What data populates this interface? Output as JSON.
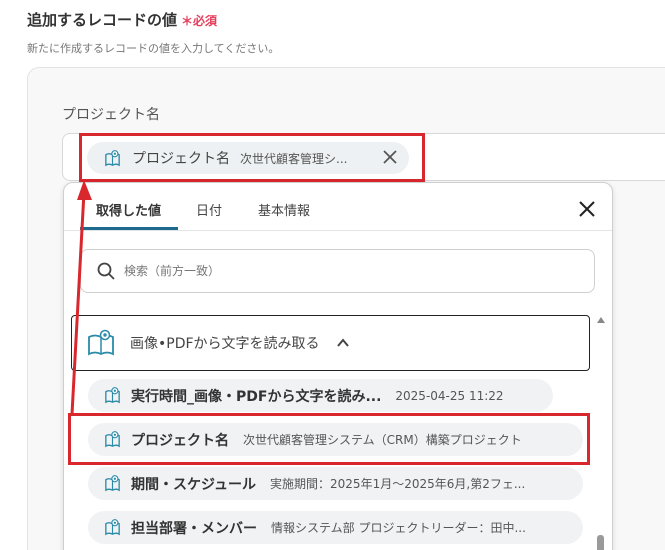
{
  "section": {
    "title": "追加するレコードの値",
    "required_mark": "＊必須",
    "description": "新たに作成するレコードの値を入力してください。"
  },
  "field": {
    "label": "プロジェクト名",
    "chip": {
      "label": "プロジェクト名",
      "value": "次世代顧客管理シ..."
    }
  },
  "panel": {
    "tabs": [
      {
        "label": "取得した値",
        "active": true
      },
      {
        "label": "日付",
        "active": false
      },
      {
        "label": "基本情報",
        "active": false
      }
    ],
    "search_placeholder": "検索（前方一致）",
    "group": {
      "label": "画像•PDFから文字を読み取る",
      "icon": "book-eye-icon",
      "expanded": true
    },
    "items": [
      {
        "label": "実行時間_画像・PDFから文字を読み...",
        "value": "2025-04-25 11:22"
      },
      {
        "label": "プロジェクト名",
        "value": "次世代顧客管理システム（CRM）構築プロジェクト"
      },
      {
        "label": "期間・スケジュール",
        "value": "実施期間：2025年1月〜2025年6月,第2フェ..."
      },
      {
        "label": "担当部署・メンバー",
        "value": "情報システム部 プロジェクトリーダー：田中..."
      }
    ]
  },
  "colors": {
    "highlight": "#d9272e",
    "tab_accent": "#1e6a8f",
    "icon_teal": "#2a8aa8",
    "required": "#e53e5c"
  }
}
